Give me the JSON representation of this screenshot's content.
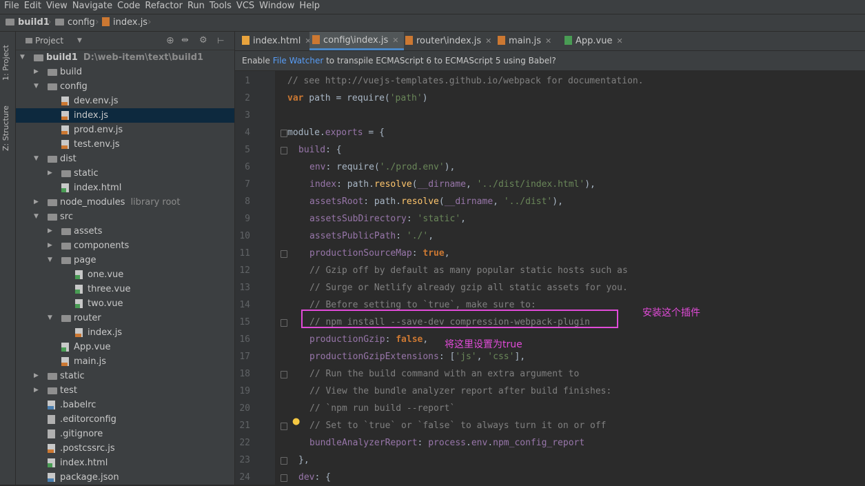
{
  "menu": [
    "File",
    "Edit",
    "View",
    "Navigate",
    "Code",
    "Refactor",
    "Run",
    "Tools",
    "VCS",
    "Window",
    "Help"
  ],
  "breadcrumb": [
    "build1",
    "config",
    "index.js"
  ],
  "left_tabs": [
    "1: Project",
    "Z: Structure"
  ],
  "project_header": {
    "label": "Project"
  },
  "tree": [
    {
      "name": "build1",
      "hint": "D:\\web-item\\text\\build1",
      "type": "root",
      "depth": 0,
      "open": true
    },
    {
      "name": "build",
      "type": "folder",
      "depth": 1,
      "open": false
    },
    {
      "name": "config",
      "type": "folder",
      "depth": 1,
      "open": true
    },
    {
      "name": "dev.env.js",
      "type": "js",
      "depth": 2
    },
    {
      "name": "index.js",
      "type": "js",
      "depth": 2,
      "selected": true
    },
    {
      "name": "prod.env.js",
      "type": "js",
      "depth": 2
    },
    {
      "name": "test.env.js",
      "type": "js",
      "depth": 2
    },
    {
      "name": "dist",
      "type": "folder",
      "depth": 1,
      "open": true
    },
    {
      "name": "static",
      "type": "folder",
      "depth": 2,
      "open": false
    },
    {
      "name": "index.html",
      "type": "html",
      "depth": 2
    },
    {
      "name": "node_modules",
      "hint": "library root",
      "type": "folder",
      "depth": 1,
      "open": false
    },
    {
      "name": "src",
      "type": "folder",
      "depth": 1,
      "open": true
    },
    {
      "name": "assets",
      "type": "folder",
      "depth": 2,
      "open": false
    },
    {
      "name": "components",
      "type": "folder",
      "depth": 2,
      "open": false
    },
    {
      "name": "page",
      "type": "folder",
      "depth": 2,
      "open": true
    },
    {
      "name": "one.vue",
      "type": "vue",
      "depth": 3
    },
    {
      "name": "three.vue",
      "type": "vue",
      "depth": 3
    },
    {
      "name": "two.vue",
      "type": "vue",
      "depth": 3
    },
    {
      "name": "router",
      "type": "folder",
      "depth": 2,
      "open": true
    },
    {
      "name": "index.js",
      "type": "js",
      "depth": 3
    },
    {
      "name": "App.vue",
      "type": "vue",
      "depth": 2
    },
    {
      "name": "main.js",
      "type": "js",
      "depth": 2
    },
    {
      "name": "static",
      "type": "folder",
      "depth": 1,
      "open": false
    },
    {
      "name": "test",
      "type": "folder",
      "depth": 1,
      "open": false
    },
    {
      "name": ".babelrc",
      "type": "json",
      "depth": 1
    },
    {
      "name": ".editorconfig",
      "type": "txt",
      "depth": 1
    },
    {
      "name": ".gitignore",
      "type": "txt",
      "depth": 1
    },
    {
      "name": ".postcssrc.js",
      "type": "js",
      "depth": 1
    },
    {
      "name": "index.html",
      "type": "html",
      "depth": 1
    },
    {
      "name": "package.json",
      "type": "json",
      "depth": 1
    }
  ],
  "tabs": [
    {
      "label": "index.html",
      "type": "html",
      "active": false
    },
    {
      "label": "config\\index.js",
      "type": "js",
      "active": true
    },
    {
      "label": "router\\index.js",
      "type": "js",
      "active": false
    },
    {
      "label": "main.js",
      "type": "js",
      "active": false
    },
    {
      "label": "App.vue",
      "type": "vue",
      "active": false
    }
  ],
  "notice": {
    "prefix": "Enable ",
    "link": "File Watcher",
    "suffix": " to transpile ECMAScript 6 to ECMAScript 5 using Babel?"
  },
  "code_lines": [
    {
      "n": "1",
      "tokens": [
        {
          "t": "// see http://vuejs-templates.github.io/webpack for documentation.",
          "c": "c-comment"
        }
      ],
      "indent": 0
    },
    {
      "n": "2",
      "tokens": [
        {
          "t": "var",
          "c": "c-kw"
        },
        {
          "t": " path = ",
          "c": "c-text"
        },
        {
          "t": "require",
          "c": "c-text"
        },
        {
          "t": "(",
          "c": "c-text"
        },
        {
          "t": "'path'",
          "c": "c-str"
        },
        {
          "t": ")",
          "c": "c-text"
        }
      ],
      "indent": 0
    },
    {
      "n": "3",
      "tokens": [],
      "indent": 0
    },
    {
      "n": "4",
      "tokens": [
        {
          "t": "module",
          "c": "c-text"
        },
        {
          "t": ".",
          "c": "c-text"
        },
        {
          "t": "exports",
          "c": "c-prop"
        },
        {
          "t": " = {",
          "c": "c-text"
        }
      ],
      "indent": 0
    },
    {
      "n": "5",
      "tokens": [
        {
          "t": "build",
          "c": "c-prop"
        },
        {
          "t": ": {",
          "c": "c-text"
        }
      ],
      "indent": 1
    },
    {
      "n": "6",
      "tokens": [
        {
          "t": "env",
          "c": "c-prop"
        },
        {
          "t": ": ",
          "c": "c-text"
        },
        {
          "t": "require",
          "c": "c-text"
        },
        {
          "t": "(",
          "c": "c-text"
        },
        {
          "t": "'./prod.env'",
          "c": "c-str"
        },
        {
          "t": "),",
          "c": "c-text"
        }
      ],
      "indent": 2
    },
    {
      "n": "7",
      "tokens": [
        {
          "t": "index",
          "c": "c-prop"
        },
        {
          "t": ": path.",
          "c": "c-text"
        },
        {
          "t": "resolve",
          "c": "c-fn"
        },
        {
          "t": "(",
          "c": "c-text"
        },
        {
          "t": "__dirname",
          "c": "c-prop"
        },
        {
          "t": ", ",
          "c": "c-text"
        },
        {
          "t": "'../dist/index.html'",
          "c": "c-str"
        },
        {
          "t": "),",
          "c": "c-text"
        }
      ],
      "indent": 2
    },
    {
      "n": "8",
      "tokens": [
        {
          "t": "assetsRoot",
          "c": "c-prop"
        },
        {
          "t": ": path.",
          "c": "c-text"
        },
        {
          "t": "resolve",
          "c": "c-fn"
        },
        {
          "t": "(",
          "c": "c-text"
        },
        {
          "t": "__dirname",
          "c": "c-prop"
        },
        {
          "t": ", ",
          "c": "c-text"
        },
        {
          "t": "'../dist'",
          "c": "c-str"
        },
        {
          "t": "),",
          "c": "c-text"
        }
      ],
      "indent": 2
    },
    {
      "n": "9",
      "tokens": [
        {
          "t": "assetsSubDirectory",
          "c": "c-prop"
        },
        {
          "t": ": ",
          "c": "c-text"
        },
        {
          "t": "'static'",
          "c": "c-str"
        },
        {
          "t": ",",
          "c": "c-text"
        }
      ],
      "indent": 2
    },
    {
      "n": "10",
      "tokens": [
        {
          "t": "assetsPublicPath",
          "c": "c-prop"
        },
        {
          "t": ": ",
          "c": "c-text"
        },
        {
          "t": "'./'",
          "c": "c-str"
        },
        {
          "t": ",",
          "c": "c-text"
        }
      ],
      "indent": 2
    },
    {
      "n": "11",
      "tokens": [
        {
          "t": "productionSourceMap",
          "c": "c-prop"
        },
        {
          "t": ": ",
          "c": "c-text"
        },
        {
          "t": "true",
          "c": "c-bool"
        },
        {
          "t": ",",
          "c": "c-text"
        }
      ],
      "indent": 2
    },
    {
      "n": "12",
      "tokens": [
        {
          "t": "// Gzip off by default as many popular static hosts such as",
          "c": "c-comment"
        }
      ],
      "indent": 2
    },
    {
      "n": "13",
      "tokens": [
        {
          "t": "// Surge or Netlify already gzip all static assets for you.",
          "c": "c-comment"
        }
      ],
      "indent": 2
    },
    {
      "n": "14",
      "tokens": [
        {
          "t": "// Before setting to `true`, make sure to:",
          "c": "c-comment"
        }
      ],
      "indent": 2
    },
    {
      "n": "15",
      "tokens": [
        {
          "t": "// npm install --save-dev compression-webpack-plugin",
          "c": "c-comment"
        }
      ],
      "indent": 2
    },
    {
      "n": "16",
      "tokens": [
        {
          "t": "productionGzip",
          "c": "c-prop"
        },
        {
          "t": ": ",
          "c": "c-text"
        },
        {
          "t": "false",
          "c": "c-bool"
        },
        {
          "t": ",",
          "c": "c-text"
        }
      ],
      "indent": 2
    },
    {
      "n": "17",
      "tokens": [
        {
          "t": "productionGzipExtensions",
          "c": "c-prop"
        },
        {
          "t": ": [",
          "c": "c-text"
        },
        {
          "t": "'js'",
          "c": "c-str"
        },
        {
          "t": ", ",
          "c": "c-text"
        },
        {
          "t": "'css'",
          "c": "c-str"
        },
        {
          "t": "],",
          "c": "c-text"
        }
      ],
      "indent": 2
    },
    {
      "n": "18",
      "tokens": [
        {
          "t": "// Run the build command with an extra argument to",
          "c": "c-comment"
        }
      ],
      "indent": 2
    },
    {
      "n": "19",
      "tokens": [
        {
          "t": "// View the bundle analyzer report after build finishes:",
          "c": "c-comment"
        }
      ],
      "indent": 2
    },
    {
      "n": "20",
      "tokens": [
        {
          "t": "// `npm run build --report`",
          "c": "c-comment"
        }
      ],
      "indent": 2
    },
    {
      "n": "21",
      "tokens": [
        {
          "t": "// Set to `true` or `false` to always turn it on or off",
          "c": "c-comment"
        }
      ],
      "indent": 2
    },
    {
      "n": "22",
      "tokens": [
        {
          "t": "bundleAnalyzerReport",
          "c": "c-prop"
        },
        {
          "t": ": ",
          "c": "c-text"
        },
        {
          "t": "process",
          "c": "c-prop"
        },
        {
          "t": ".",
          "c": "c-text"
        },
        {
          "t": "env",
          "c": "c-prop"
        },
        {
          "t": ".",
          "c": "c-text"
        },
        {
          "t": "npm_config_report",
          "c": "c-prop"
        }
      ],
      "indent": 2
    },
    {
      "n": "23",
      "tokens": [
        {
          "t": "},",
          "c": "c-text"
        }
      ],
      "indent": 1
    },
    {
      "n": "24",
      "tokens": [
        {
          "t": "dev",
          "c": "c-prop"
        },
        {
          "t": ": {",
          "c": "c-text"
        }
      ],
      "indent": 1
    }
  ],
  "annotations": {
    "install_plugin": "安装这个插件",
    "set_true": "将这里设置为true"
  },
  "colors": {
    "highlight_box": "#e24bd9",
    "accent": "#4a88c7"
  }
}
